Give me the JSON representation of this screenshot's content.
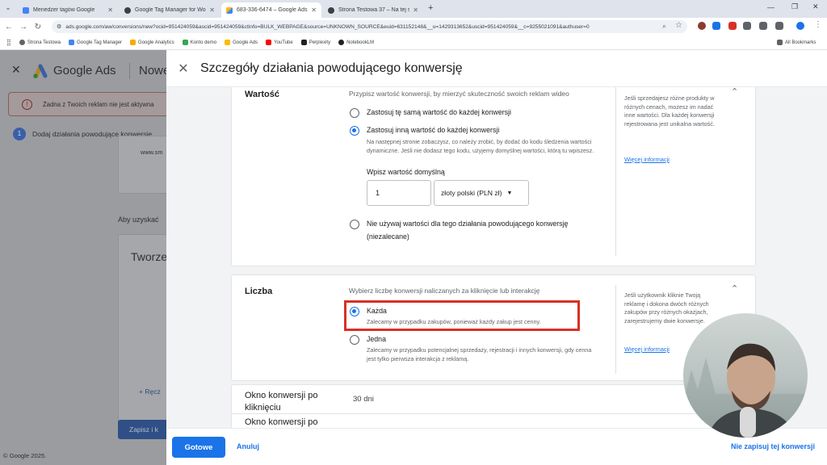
{
  "browser": {
    "tabs": [
      {
        "title": "Menedżer tagów Google",
        "color": "#4285f4"
      },
      {
        "title": "Google Tag Manager for WordPress",
        "color": "#3c4043"
      },
      {
        "title": "683-336-6474 – Google Ads",
        "color": "#fbbc04"
      },
      {
        "title": "Strona Testowa 37 – Na tej stronie",
        "color": "#3c4043"
      }
    ],
    "new_tab": "+",
    "url": "ads.google.com/aw/conversions/new?ocid=951424059&ascid=951424059&ctinfo=BULK_WEBPAGE&source=UNKNOWN_SOURCE&euid=631152148&__u=1429313652&uscid=951424059&__c=9255021091&authuser=0",
    "bookmarks": [
      {
        "label": "Strona Testowa",
        "color": "#5f6368"
      },
      {
        "label": "Google Tag Manager",
        "color": "#4285f4"
      },
      {
        "label": "Google Analytics",
        "color": "#f9ab00"
      },
      {
        "label": "Konto demo",
        "color": "#34a853"
      },
      {
        "label": "Google Ads",
        "color": "#fbbc04"
      },
      {
        "label": "YouTube",
        "color": "#ff0000"
      },
      {
        "label": "Perplexity",
        "color": "#202124"
      },
      {
        "label": "NotebookLM",
        "color": "#202124"
      }
    ],
    "all_bookmarks": "All Bookmarks"
  },
  "background": {
    "brand": "Google Ads",
    "heading_fragment": "Nowe",
    "alert": "Żadna z Twoich reklam nie jest aktywna",
    "step_number": "1",
    "step_label": "Dodaj działania powodujące konwersje",
    "url_fragment": "www.sm",
    "aby_fragment": "Aby uzyskać",
    "tworz_fragment": "Tworze",
    "recznie_fragment": "+ Ręcz",
    "save_fragment": "Zapisz i k",
    "copyright": "© Google 2025."
  },
  "modal": {
    "close_glyph": "✕",
    "title": "Szczegóły działania powodującego konwersję",
    "value_section": {
      "title": "Wartość",
      "description": "Przypisz wartość konwersji, by mierzyć skuteczność swoich reklam wideo",
      "option_same": "Zastosuj tę samą wartość do każdej konwersji",
      "option_different": "Zastosuj inną wartość do każdej konwersji",
      "option_different_desc": "Na następnej stronie zobaczysz, co należy zrobić, by dodać do kodu śledzenia wartości dynamiczne. Jeśli nie dodasz tego kodu, użyjemy domyślnej wartości, którą tu wpiszesz.",
      "default_label": "Wpisz wartość domyślną",
      "default_value": "1",
      "currency": "złoty polski (PLN zł)",
      "option_none": "Nie używaj wartości dla tego działania powodującego konwersję",
      "option_none_note": "(niezalecane)",
      "help": "Jeśli sprzedajesz różne produkty w różnych cenach, możesz im nadać inne wartości. Dla każdej konwersji rejestrowana jest unikalna wartość.",
      "help_link": "Więcej informacji",
      "selected": "different"
    },
    "count_section": {
      "title": "Liczba",
      "description": "Wybierz liczbę konwersji naliczanych za kliknięcie lub interakcję",
      "option_each": "Każda",
      "option_each_desc": "Zalecamy w przypadku zakupów, ponieważ każdy zakup jest cenny.",
      "option_one": "Jedna",
      "option_one_desc": "Zalecamy w przypadku potencjalnej sprzedaży, rejestracji i innych konwersji, gdy cenna jest tylko pierwsza interakcja z reklamą.",
      "help": "Jeśli użytkownik kliknie Twoją reklamę i dokona dwóch różnych zakupów przy różnych okazjach, zarejestrujemy dwie konwersje.",
      "help_link": "Więcej informacji",
      "selected": "each",
      "highlight_color": "#d93025"
    },
    "click_window": {
      "label": "Okno konwersji po kliknięciu",
      "value": "30 dni"
    },
    "view_window_label": "Okno konwersji po",
    "footer": {
      "done": "Gotowe",
      "cancel": "Anuluj",
      "dont_save": "Nie zapisuj tej konwersji"
    }
  },
  "colors": {
    "accent": "#1a73e8",
    "highlight": "#d93025"
  }
}
